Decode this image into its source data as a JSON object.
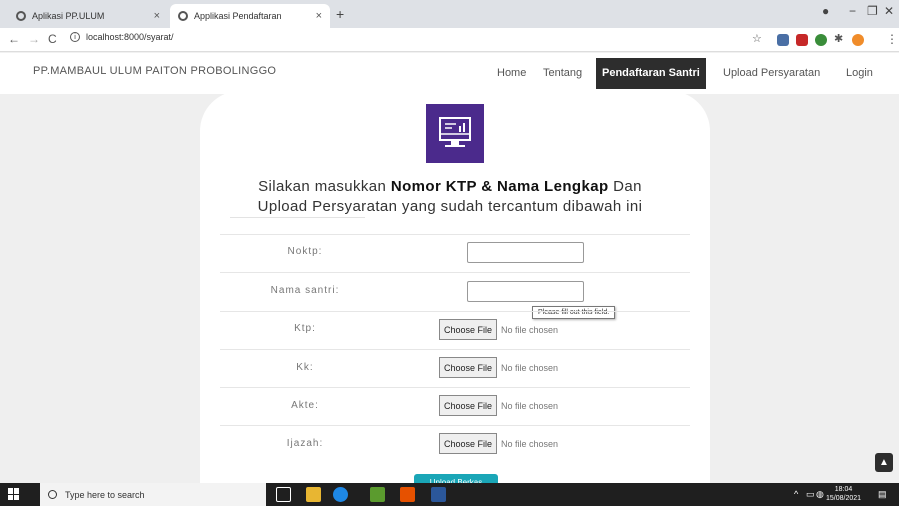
{
  "browser": {
    "tabs": [
      {
        "title": "Aplikasi PP.ULUM",
        "active": false
      },
      {
        "title": "Applikasi Pendaftaran",
        "active": true
      }
    ],
    "url": "localhost:8000/syarat/"
  },
  "site": {
    "brand": "PP.MAMBAUL ULUM PAITON PROBOLINGGO",
    "nav": [
      "Home",
      "Tentang",
      "Pendaftaran Santri",
      "Upload Persyaratan",
      "Login"
    ]
  },
  "headline": {
    "line1_pre": "Silakan masukkan ",
    "line1_bold": "Nomor KTP & Nama Lengkap",
    "line1_post": " Dan",
    "line2": "Upload Persyaratan yang sudah tercantum dibawah ini"
  },
  "form": {
    "noktp_label": "Noktp:",
    "nama_label": "Nama santri:",
    "files": [
      {
        "label": "Ktp:"
      },
      {
        "label": "Kk:"
      },
      {
        "label": "Akte:"
      },
      {
        "label": "Ijazah:"
      }
    ],
    "choose_label": "Choose File",
    "no_file_text": "No file chosen",
    "validation_tooltip": "Please fill out this field.",
    "submit_label": "Upload Berkas"
  },
  "taskbar": {
    "search_placeholder": "Type here to search",
    "time": "18:04",
    "date": "15/08/2021"
  }
}
